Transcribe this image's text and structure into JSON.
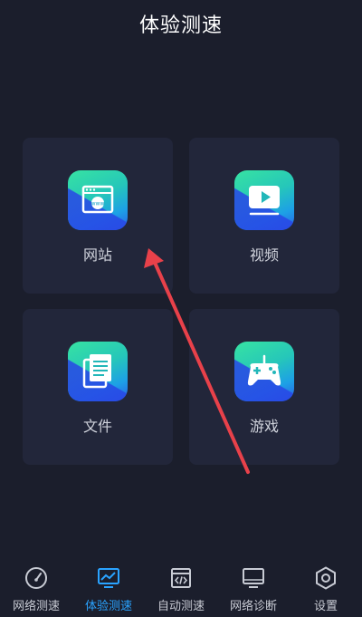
{
  "header": {
    "title": "体验测速"
  },
  "cards": [
    {
      "label": "网站",
      "icon": "website-icon"
    },
    {
      "label": "视频",
      "icon": "video-icon"
    },
    {
      "label": "文件",
      "icon": "file-icon"
    },
    {
      "label": "游戏",
      "icon": "gamepad-icon"
    }
  ],
  "tabs": [
    {
      "label": "网络测速",
      "icon": "speedometer-icon",
      "active": false
    },
    {
      "label": "体验测速",
      "icon": "monitor-chart-icon",
      "active": true
    },
    {
      "label": "自动测速",
      "icon": "code-calendar-icon",
      "active": false
    },
    {
      "label": "网络诊断",
      "icon": "monitor-icon",
      "active": false
    },
    {
      "label": "设置",
      "icon": "hexagon-gear-icon",
      "active": false
    }
  ],
  "colors": {
    "background": "#1b1e2c",
    "card": "#22263a",
    "accent": "#2aa3ff",
    "annotation_arrow": "#e8414a"
  }
}
